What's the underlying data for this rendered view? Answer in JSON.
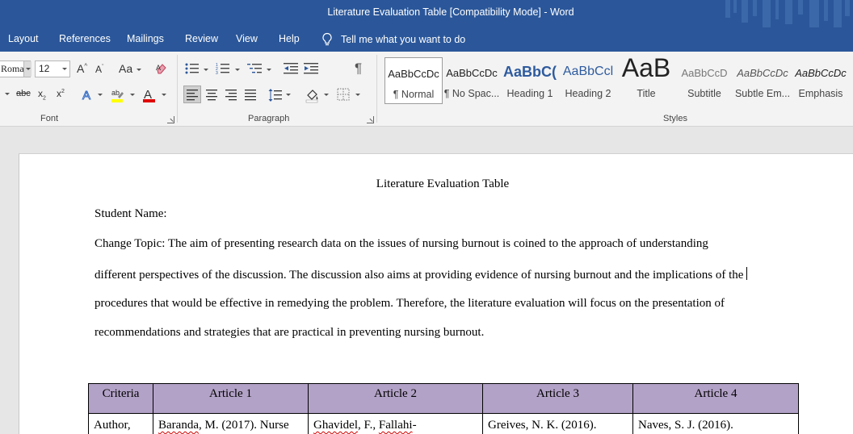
{
  "window": {
    "title": "Literature Evaluation Table [Compatibility Mode]  -  Word"
  },
  "tabs": [
    {
      "label": "Layout"
    },
    {
      "label": "References"
    },
    {
      "label": "Mailings"
    },
    {
      "label": "Review"
    },
    {
      "label": "View"
    },
    {
      "label": "Help"
    }
  ],
  "tell_me": {
    "label": "Tell me what you want to do"
  },
  "ribbon": {
    "font": {
      "name": "Roma",
      "size": "12",
      "group_label": "Font",
      "change_case": "Aa"
    },
    "paragraph": {
      "group_label": "Paragraph"
    },
    "styles": {
      "group_label": "Styles",
      "items": [
        {
          "sample": "AaBbCcDc",
          "name": "¶ Normal"
        },
        {
          "sample": "AaBbCcDc",
          "name": "¶ No Spac..."
        },
        {
          "sample": "AaBbC(",
          "name": "Heading 1"
        },
        {
          "sample": "AaBbCcl",
          "name": "Heading 2"
        },
        {
          "sample": "AaB",
          "name": "Title"
        },
        {
          "sample": "AaBbCcD",
          "name": "Subtitle"
        },
        {
          "sample": "AaBbCcDc",
          "name": "Subtle Em..."
        },
        {
          "sample": "AaBbCcDc",
          "name": "Emphasis"
        }
      ]
    }
  },
  "document": {
    "title": "Literature Evaluation Table",
    "student_name": "Student Name:",
    "topic_lines": [
      "Change Topic: The aim of presenting research data on the issues of nursing burnout is coined to the approach of understanding",
      "different perspectives of the discussion. The discussion also aims at providing evidence of nursing burnout and the implications of the",
      "procedures that would be effective in remedying the problem. Therefore, the literature evaluation will focus on the presentation of",
      "recommendations and strategies that are practical in preventing nursing burnout."
    ],
    "table": {
      "headers": [
        "Criteria",
        "Article 1",
        "Article 2",
        "Article 3",
        "Article 4"
      ],
      "row1": {
        "criteria": "Author,",
        "a1_name": "Baranda",
        "a1_rest": ", M. (2017). Nurse",
        "a2_name": "Ghavidel",
        "a2_mid": ", F., ",
        "a2_name2": "Fallahi",
        "a2_rest": "-",
        "a3": "Greives, N. K. (2016).",
        "a4": "Naves, S. J. (2016)."
      }
    }
  },
  "colors": {
    "title_bar": "#2b579a",
    "ribbon": "#f3f3f3",
    "table_header": "#b3a2c7",
    "spell_error": "#d00000"
  }
}
